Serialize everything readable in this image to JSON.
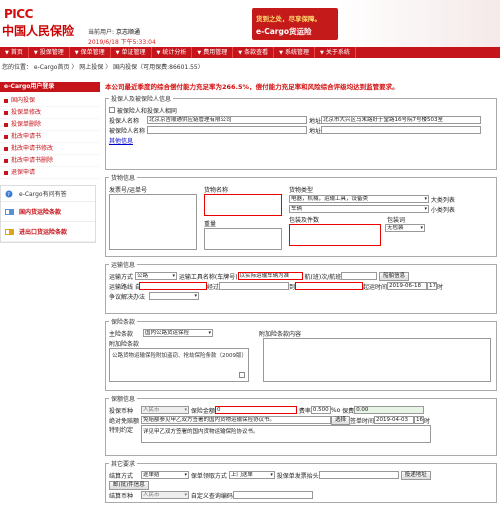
{
  "header": {
    "brand": "PICC",
    "company": "中国人民保险",
    "user_label": "当前用户:",
    "user_value": "京志顺通",
    "datetime": "2019/6/18 下午5:33:04",
    "slogan": "货到之处，尽享保障。",
    "product": "e-Cargo货运险"
  },
  "nav": [
    "首页",
    "投保管理",
    "保单管理",
    "单证管理",
    "统计分析",
    "费用管理",
    "条款查看",
    "系统管理",
    "关于系统"
  ],
  "breadcrumb": "您的位置： e-Cargo首页 〉 网上投保 〉 国内投保（可用保费:86601.55）",
  "sidebar": {
    "title": "e-Cargo用户登录",
    "items": [
      "国内投保",
      "投保单修改",
      "投保单删除",
      "批改申请书",
      "批改申请书修改",
      "批改申请书删除",
      "退保申请"
    ],
    "box_title": "e-Cargo有问有答",
    "box_items": [
      "国内货运险条款",
      "进出口货运险条款"
    ]
  },
  "alert": "本公司最近季度的综合偿付能力充足率为266.5%，偿付能力充足率和风险综合评级均达到监管要求。",
  "insured": {
    "legend": "投保人及被保险人信息",
    "same_label": "被保险人和投保人相同",
    "applicant_label": "投保人名称",
    "applicant_value": "北京京吉顺通供应链管理有限公司",
    "address_label": "地址",
    "address_value": "北京市大兴区马末路好于堂路16号院7号楼503室",
    "insured_label": "被保险人名称",
    "insured_addr_label": "地址",
    "more_link": "其他信息"
  },
  "goods": {
    "legend": "货物信息",
    "mark_label": "发票号/运单号",
    "name_label": "货物名称",
    "type_label": "货物类型",
    "type_value": "电器，机械，运输工具，设备类",
    "big_label": "大类列表",
    "sub_value": "车辆",
    "sub_label": "小类列表",
    "weight_label": "重量",
    "pack_label": "包装及件数",
    "pack_method_label": "包装词",
    "pack_method_value": "无包装"
  },
  "transport": {
    "legend": "运输信息",
    "mode_label": "运输方式",
    "mode_value": "公路",
    "tool_label": "运输工具名称(车牌号)",
    "tool_value": "以实际运输车辆为准",
    "voyage_label": "航(班)次/航班",
    "voyage_btn": "船舶信息",
    "from_label": "运输路线 自",
    "via_label": "经过",
    "to_label": "到",
    "depart_label": "起运时间",
    "depart_value": "2019-06-18",
    "hour_value": "17",
    "hour_label": "时",
    "claim_label": "争议解决办法"
  },
  "clause": {
    "legend": "保险条款",
    "main_label": "主险条款",
    "main_value": "国内公路货运保险",
    "extra_label": "附加险条款",
    "extra_content_label": "附加险条款内容",
    "list_text": "公路货物运输保险附加盗窃、抢劫保险条款（2009版）"
  },
  "amount": {
    "legend": "保额信息",
    "currency_label": "投保币种",
    "currency_value": "人民币",
    "sum_label": "保险金额",
    "sum_value": "0",
    "rate_label": "费率",
    "rate_value": "0.500",
    "rate_unit": "%o",
    "premium_label": "保费",
    "premium_value": "0.00",
    "deduct_label": "绝对免赔额",
    "deduct_value": "免赔额参见甲乙双方签署的国内货物运输保险协议书。",
    "choose_btn": "选择",
    "sign_label": "签单时间",
    "sign_value": "2019-04-03",
    "sign_hour": "16",
    "sign_hour_label": "时",
    "special_label": "特别约定",
    "special_value": "详见甲乙双方签署的国内货物运输保险协议书。"
  },
  "other": {
    "legend": "其它要求",
    "settle_label": "结算方式",
    "settle_value": "逐单结",
    "delivery_label": "保单领取方式",
    "delivery_value": "上门送单",
    "recv_label": "投保单发票抬头",
    "recv_btn": "投递地址",
    "mail_btn": "邮(批)件信息",
    "settle_cur_label": "结算币种",
    "settle_cur_value": "人民币",
    "custom_label": "自定义查询编码"
  }
}
